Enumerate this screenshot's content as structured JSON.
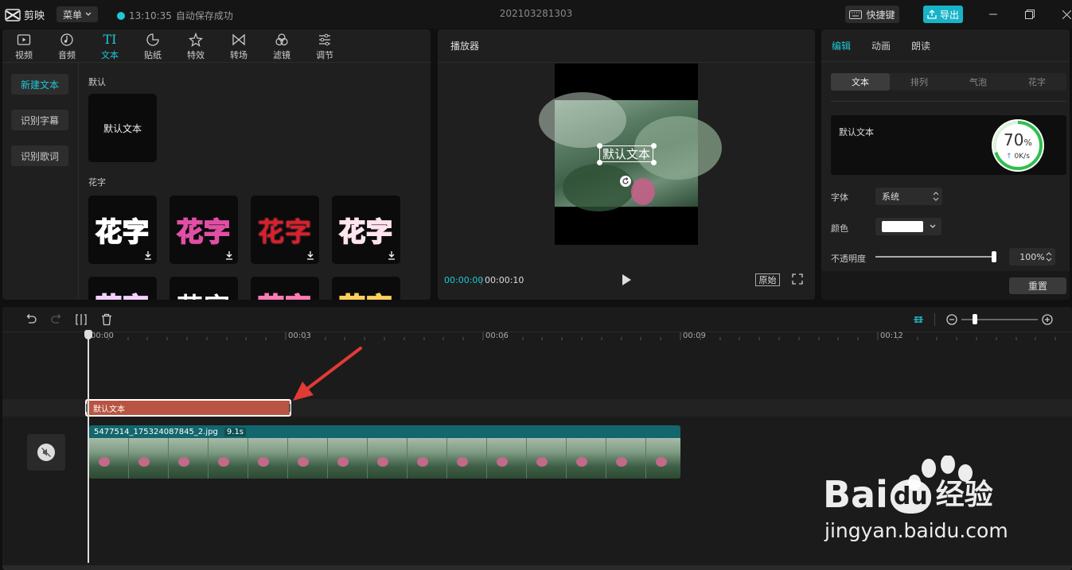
{
  "titlebar": {
    "app_name": "剪映",
    "menu_label": "菜单",
    "autosave_time": "13:10:35",
    "autosave_text": "自动保存成功",
    "project_name": "202103281303",
    "shortcut_label": "快捷键",
    "export_label": "导出"
  },
  "library": {
    "tabs": [
      {
        "label": "视频",
        "icon": "video-icon"
      },
      {
        "label": "音频",
        "icon": "audio-icon"
      },
      {
        "label": "文本",
        "icon": "text-icon",
        "glyph": "TI"
      },
      {
        "label": "贴纸",
        "icon": "sticker-icon"
      },
      {
        "label": "特效",
        "icon": "effects-icon"
      },
      {
        "label": "转场",
        "icon": "transition-icon"
      },
      {
        "label": "滤镜",
        "icon": "filter-icon"
      },
      {
        "label": "调节",
        "icon": "adjust-icon"
      }
    ],
    "side_buttons": [
      "新建文本",
      "识别字幕",
      "识别歌词"
    ],
    "default_section": "默认",
    "default_card": "默认文本",
    "fancy_section": "花字",
    "fancy_text": "花字"
  },
  "player": {
    "title": "播放器",
    "overlay_text": "默认文本",
    "current_time": "00:00:00",
    "total_time": "00:00:10",
    "original_label": "原始"
  },
  "props": {
    "tabs": [
      "编辑",
      "动画",
      "朗读"
    ],
    "segments": [
      "文本",
      "排列",
      "气泡",
      "花字"
    ],
    "text_value": "默认文本",
    "gauge_value": "70",
    "gauge_unit": "%",
    "gauge_speed": "0K/s",
    "font_label": "字体",
    "font_value": "系统",
    "color_label": "颜色",
    "color_value": "#ffffff",
    "opacity_label": "不透明度",
    "opacity_value": "100%",
    "reset_label": "重置"
  },
  "timeline": {
    "ruler": [
      "00:00",
      "00:03",
      "00:06",
      "00:09",
      "00:12"
    ],
    "text_clip_label": "默认文本",
    "video_clip_name": "5477514_175324087845_2.jpg",
    "video_clip_duration": "9.1s"
  },
  "watermark": {
    "brand": "Bai",
    "brand_du": "du",
    "cn": "经验",
    "url": "jingyan.baidu.com"
  },
  "colors": {
    "accent": "#1fc8d6",
    "text_clip": "#b85441",
    "video_clip": "#12666c",
    "arrow": "#e23a35"
  }
}
